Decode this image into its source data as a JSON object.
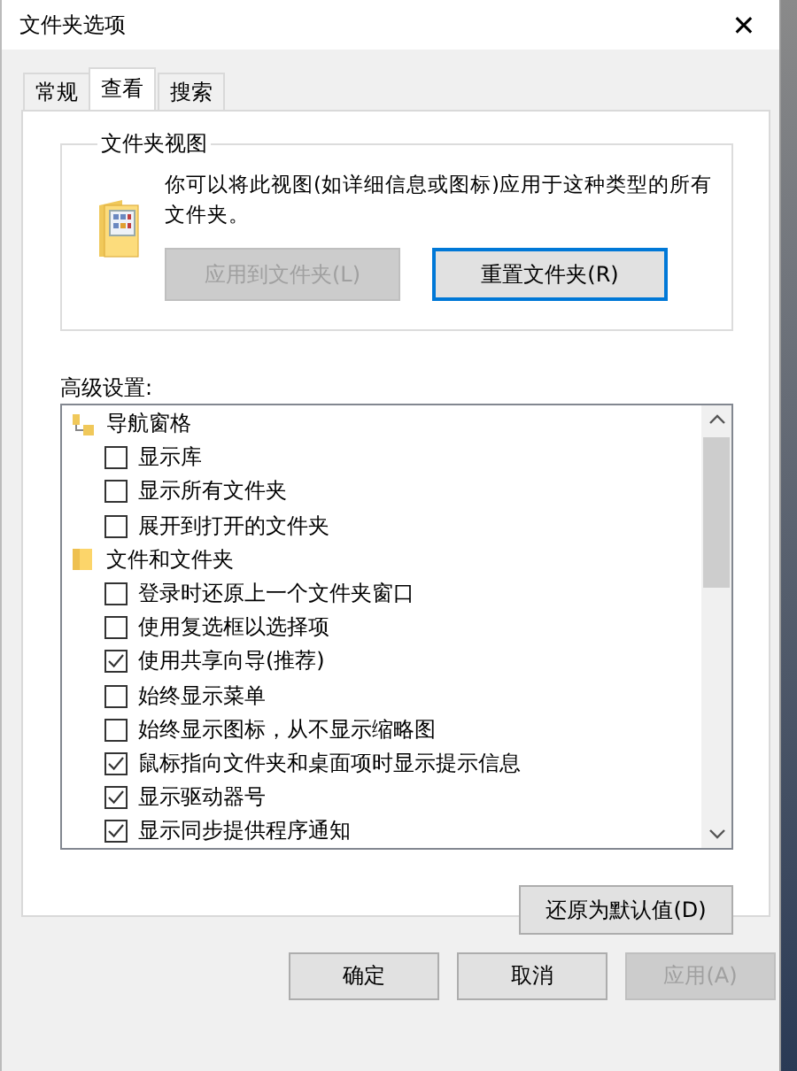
{
  "window": {
    "title": "文件夹选项",
    "close": "✕"
  },
  "tabs": [
    {
      "label": "常规",
      "selected": false
    },
    {
      "label": "查看",
      "selected": true
    },
    {
      "label": "搜索",
      "selected": false
    }
  ],
  "folder_views": {
    "legend": "文件夹视图",
    "description": "你可以将此视图(如详细信息或图标)应用于这种类型的所有文件夹。",
    "buttons": [
      {
        "label": "应用到文件夹(L)",
        "disabled": true,
        "focused": false
      },
      {
        "label": "重置文件夹(R)",
        "disabled": false,
        "focused": true
      }
    ]
  },
  "advanced": {
    "label": "高级设置:",
    "items": [
      {
        "label": "导航窗格",
        "kind": "pane",
        "children": [
          {
            "label": "显示库",
            "checked": false
          },
          {
            "label": "显示所有文件夹",
            "checked": false
          },
          {
            "label": "展开到打开的文件夹",
            "checked": false
          }
        ]
      },
      {
        "label": "文件和文件夹",
        "kind": "folder",
        "children": [
          {
            "label": "登录时还原上一个文件夹窗口",
            "checked": false
          },
          {
            "label": "使用复选框以选择项",
            "checked": false
          },
          {
            "label": "使用共享向导(推荐)",
            "checked": true
          },
          {
            "label": "始终显示菜单",
            "checked": false
          },
          {
            "label": "始终显示图标，从不显示缩略图",
            "checked": false
          },
          {
            "label": "鼠标指向文件夹和桌面项时显示提示信息",
            "checked": true
          },
          {
            "label": "显示驱动器号",
            "checked": true
          },
          {
            "label": "显示同步提供程序通知",
            "checked": true
          }
        ]
      }
    ]
  },
  "restore_button": "还原为默认值(D)",
  "buttons": [
    {
      "label": "确定",
      "disabled": false
    },
    {
      "label": "取消",
      "disabled": false
    },
    {
      "label": "应用(A)",
      "disabled": true
    }
  ]
}
